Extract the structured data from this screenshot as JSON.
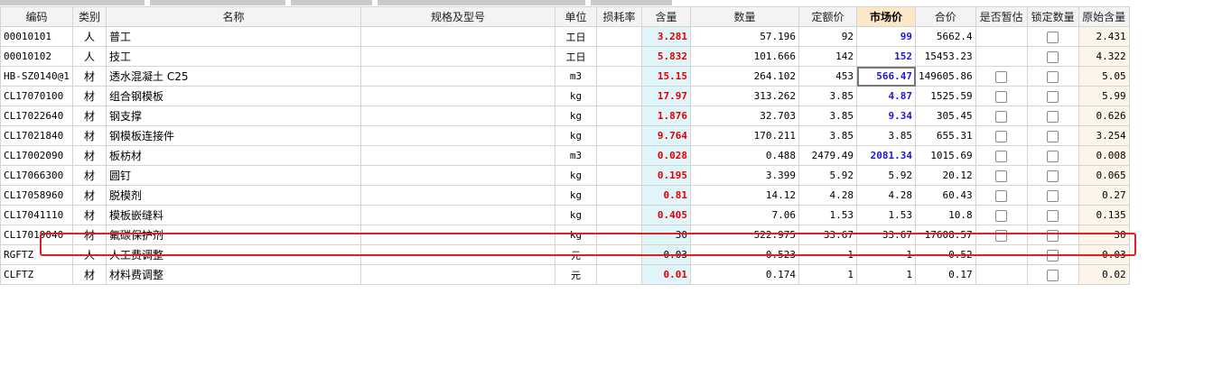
{
  "headers": {
    "code": "编码",
    "type": "类别",
    "name": "名称",
    "spec": "规格及型号",
    "unit": "单位",
    "loss": "损耗率",
    "content": "含量",
    "quantity": "数量",
    "quota_price": "定额价",
    "market_price": "市场价",
    "total": "合价",
    "provisional": "是否暂估",
    "lock_qty": "锁定数量",
    "orig_content": "原始含量"
  },
  "rows": [
    {
      "code": "00010101",
      "type": "人",
      "name": "普工",
      "spec": "",
      "unit": "工日",
      "loss": "",
      "content": "3.281",
      "quantity": "57.196",
      "quota_price": "92",
      "market_price": "99",
      "total": "5662.4",
      "provisional": null,
      "lock": false,
      "orig": "2.431",
      "content_red": true,
      "market_blue": true
    },
    {
      "code": "00010102",
      "type": "人",
      "name": "技工",
      "spec": "",
      "unit": "工日",
      "loss": "",
      "content": "5.832",
      "quantity": "101.666",
      "quota_price": "142",
      "market_price": "152",
      "total": "15453.23",
      "provisional": null,
      "lock": false,
      "orig": "4.322",
      "content_red": true,
      "market_blue": true
    },
    {
      "code": "HB-SZ0140@1",
      "type": "材",
      "name": "透水混凝土 C25",
      "spec": "",
      "unit": "m3",
      "loss": "",
      "content": "15.15",
      "quantity": "264.102",
      "quota_price": "453",
      "market_price": "566.47",
      "total": "149605.86",
      "provisional": false,
      "lock": false,
      "orig": "5.05",
      "content_red": true,
      "market_blue": true,
      "market_selected": true
    },
    {
      "code": "CL17070100",
      "type": "材",
      "name": "组合钢模板",
      "spec": "",
      "unit": "kg",
      "loss": "",
      "content": "17.97",
      "quantity": "313.262",
      "quota_price": "3.85",
      "market_price": "4.87",
      "total": "1525.59",
      "provisional": false,
      "lock": false,
      "orig": "5.99",
      "content_red": true,
      "market_blue": true
    },
    {
      "code": "CL17022640",
      "type": "材",
      "name": "钢支撑",
      "spec": "",
      "unit": "kg",
      "loss": "",
      "content": "1.876",
      "quantity": "32.703",
      "quota_price": "3.85",
      "market_price": "9.34",
      "total": "305.45",
      "provisional": false,
      "lock": false,
      "orig": "0.626",
      "content_red": true,
      "market_blue": true
    },
    {
      "code": "CL17021840",
      "type": "材",
      "name": "钢模板连接件",
      "spec": "",
      "unit": "kg",
      "loss": "",
      "content": "9.764",
      "quantity": "170.211",
      "quota_price": "3.85",
      "market_price": "3.85",
      "total": "655.31",
      "provisional": false,
      "lock": false,
      "orig": "3.254",
      "content_red": true,
      "market_blue": false
    },
    {
      "code": "CL17002090",
      "type": "材",
      "name": "板枋材",
      "spec": "",
      "unit": "m3",
      "loss": "",
      "content": "0.028",
      "quantity": "0.488",
      "quota_price": "2479.49",
      "market_price": "2081.34",
      "total": "1015.69",
      "provisional": false,
      "lock": false,
      "orig": "0.008",
      "content_red": true,
      "market_blue": true
    },
    {
      "code": "CL17066300",
      "type": "材",
      "name": "圆钉",
      "spec": "",
      "unit": "kg",
      "loss": "",
      "content": "0.195",
      "quantity": "3.399",
      "quota_price": "5.92",
      "market_price": "5.92",
      "total": "20.12",
      "provisional": false,
      "lock": false,
      "orig": "0.065",
      "content_red": true,
      "market_blue": false
    },
    {
      "code": "CL17058960",
      "type": "材",
      "name": "脱模剂",
      "spec": "",
      "unit": "kg",
      "loss": "",
      "content": "0.81",
      "quantity": "14.12",
      "quota_price": "4.28",
      "market_price": "4.28",
      "total": "60.43",
      "provisional": false,
      "lock": false,
      "orig": "0.27",
      "content_red": true,
      "market_blue": false
    },
    {
      "code": "CL17041110",
      "type": "材",
      "name": "模板嵌缝料",
      "spec": "",
      "unit": "kg",
      "loss": "",
      "content": "0.405",
      "quantity": "7.06",
      "quota_price": "1.53",
      "market_price": "1.53",
      "total": "10.8",
      "provisional": false,
      "lock": false,
      "orig": "0.135",
      "content_red": true,
      "market_blue": false
    },
    {
      "code": "CL17019040",
      "type": "材",
      "name": "氟碳保护剂",
      "spec": "",
      "unit": "kg",
      "loss": "",
      "content": "30",
      "quantity": "522.975",
      "quota_price": "33.67",
      "market_price": "33.67",
      "total": "17608.57",
      "provisional": false,
      "lock": false,
      "orig": "30",
      "content_red": false,
      "market_blue": false,
      "highlighted": true
    },
    {
      "code": "RGFTZ",
      "type": "人",
      "name": "人工费调整",
      "spec": "",
      "unit": "元",
      "loss": "",
      "content": "0.03",
      "quantity": "0.523",
      "quota_price": "1",
      "market_price": "1",
      "total": "0.52",
      "provisional": null,
      "lock": false,
      "orig": "0.03",
      "content_red": false,
      "market_blue": false
    },
    {
      "code": "CLFTZ",
      "type": "材",
      "name": "材料费调整",
      "spec": "",
      "unit": "元",
      "loss": "",
      "content": "0.01",
      "quantity": "0.174",
      "quota_price": "1",
      "market_price": "1",
      "total": "0.17",
      "provisional": null,
      "lock": false,
      "orig": "0.02",
      "content_red": true,
      "market_blue": false
    }
  ],
  "colors": {
    "content_bg": "#dff5fa",
    "content_red": "#e10000",
    "market_blue": "#1f17d3",
    "market_header_bg": "#fce7c8",
    "orig_bg": "#fdf4ea",
    "highlight_border": "#e0201f"
  },
  "icons": {
    "checkbox": "checkbox-icon"
  }
}
